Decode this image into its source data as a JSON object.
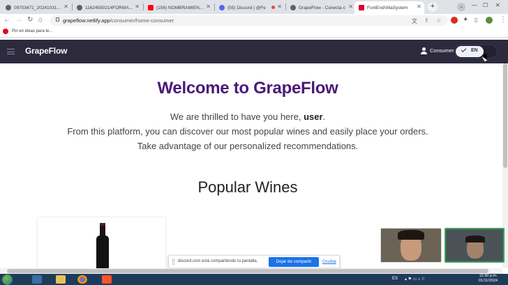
{
  "browser": {
    "tabs": [
      {
        "label": "09703471_20241031211",
        "favicon_color": "#5f6368"
      },
      {
        "label": "11624550214FORMATO",
        "favicon_color": "#5f6368"
      },
      {
        "label": "(156) NOMBRAMIENTO",
        "favicon_color": "#ff0000"
      },
      {
        "label": "(55) Discord | @Fe",
        "favicon_color": "#5865f2"
      },
      {
        "label": "GrapeFlow - Conecta c",
        "favicon_color": "#5f6368"
      },
      {
        "label": "FontEndVillaSystem",
        "favicon_color": "#dd0031"
      }
    ],
    "new_tab_symbol": "+",
    "url_host": "grapeflow.netlify.app",
    "url_path": "/consumer/home-consumer",
    "bookmark": "Pin en ideas para te..."
  },
  "app": {
    "brand": "GrapeFlow",
    "user_role": "Consumer",
    "language": "EN",
    "accent_color": "#4a1a78",
    "header_color": "#2d2a3e"
  },
  "hero": {
    "title": "Welcome to GrapeFlow",
    "line1_prefix": "We are thrilled to have you here,",
    "line1_user": "user",
    "line1_suffix": ".",
    "line2": "From this platform, you can discover our most popular wines and easily place your orders.",
    "line3": "Take advantage of our personalized recommendations."
  },
  "popular": {
    "heading": "Popular Wines"
  },
  "share_bar": {
    "message": "discord.com está compartiendo tu pantalla.",
    "stop_button": "Dejar de compartir",
    "hide_link": "Ocultar"
  },
  "taskbar": {
    "lang": "ES",
    "time": "12:30 p.m.",
    "date": "01/11/2024"
  }
}
